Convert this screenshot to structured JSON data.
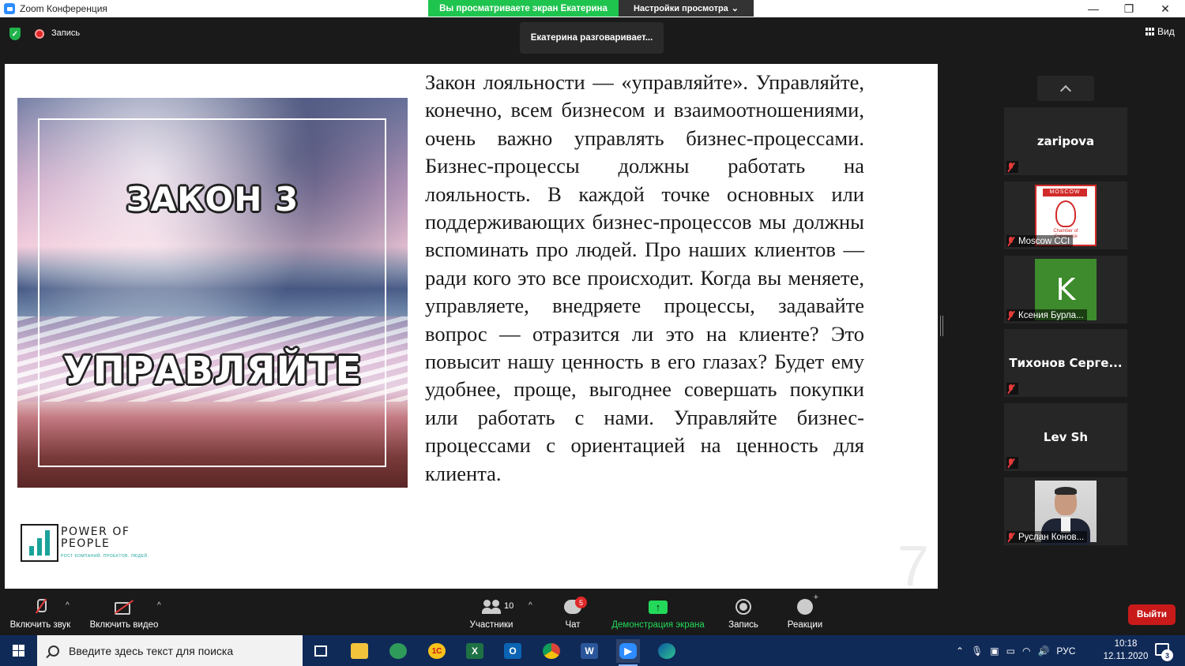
{
  "window": {
    "title": "Zoom Конференция",
    "share_banner": "Вы просматриваете экран Екатерина",
    "view_options": "Настройки просмотра",
    "controls": {
      "minimize": "—",
      "maximize": "❐",
      "close": "✕"
    }
  },
  "topbar": {
    "recording_label": "Запись",
    "speaker_tooltip": "Екатерина разговаривает...",
    "view_label": "Вид"
  },
  "slide": {
    "law_title": "ЗАКОН 3",
    "law_subtitle": "УПРАВЛЯЙТЕ",
    "logo_line1": "POWER OF",
    "logo_line2": "PEOPLE",
    "logo_tagline": "РОСТ КОМПАНИЙ. ПРОЕКТОВ. ЛЮДЕЙ.",
    "body": "Закон лояльности — «управляйте». Управляйте, конечно, всем бизнесом и взаимоотношениями, очень важно управлять бизнес-процессами. Бизнес-процессы должны работать на лояльность. В каждой точке основных или поддерживающих бизнес-процессов мы должны вспоминать про людей. Про наших клиентов — ради кого это все происходит. Когда вы меняете, управляете, внедряете процессы,  задавайте вопрос — отразится ли это на клиенте? Это повысит нашу ценность в его глазах? Будет ему удобнее, проще, выгоднее совершать покупки или работать с нами. Управляйте бизнес-процессами с ориентацией на ценность для клиента.",
    "page_number": "7"
  },
  "participants": [
    {
      "name": "zaripova",
      "kind": "name",
      "muted": true,
      "label": ""
    },
    {
      "name": "Moscow CCI",
      "kind": "logo",
      "muted": true,
      "label": "Moscow CCI",
      "logo_top": "MOSCOW",
      "logo_bottom": "Chamber of Commerce"
    },
    {
      "name": "Ксения Бурла...",
      "kind": "initial",
      "initial": "K",
      "muted": true,
      "label": "Ксения Бурла..."
    },
    {
      "name": "Тихонов Серге...",
      "kind": "name",
      "muted": true,
      "label": ""
    },
    {
      "name": "Lev Sh",
      "kind": "name",
      "muted": true,
      "label": ""
    },
    {
      "name": "Руслан Конов...",
      "kind": "photo",
      "muted": true,
      "label": "Руслан Конов..."
    }
  ],
  "toolbar": {
    "audio_label": "Включить звук",
    "video_label": "Включить видео",
    "participants_label": "Участники",
    "participants_count": "10",
    "chat_label": "Чат",
    "chat_badge": "5",
    "share_label": "Демонстрация экрана",
    "record_label": "Запись",
    "reactions_label": "Реакции",
    "leave_label": "Выйти"
  },
  "taskbar": {
    "search_placeholder": "Введите здесь текст для поиска",
    "apps": [
      "task-view",
      "file-explorer",
      "maps",
      "1c",
      "excel",
      "outlook",
      "chrome",
      "word",
      "zoom",
      "edge"
    ],
    "language": "РУС",
    "time": "10:18",
    "date": "12.11.2020",
    "notifications": "3"
  },
  "colors": {
    "zoom_bg": "#1a1a1a",
    "share_green": "#23d959",
    "leave_red": "#c91a1a",
    "taskbar_blue": "#102a58"
  }
}
